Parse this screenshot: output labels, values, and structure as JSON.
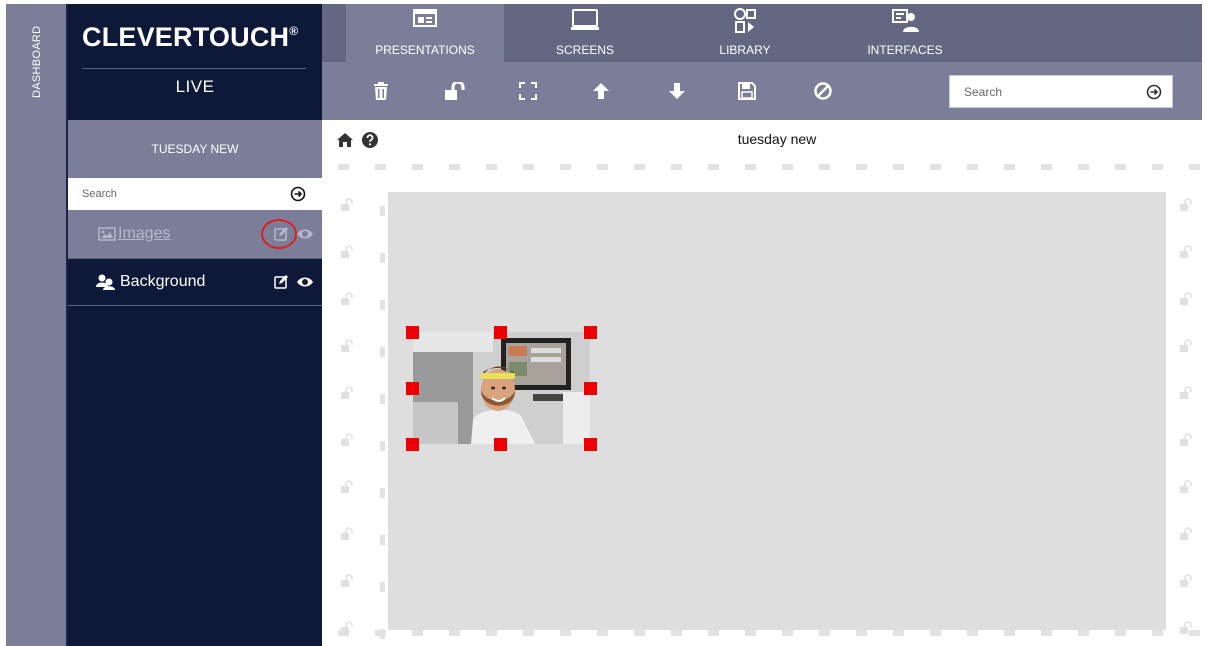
{
  "dashboard": {
    "label": "DASHBOARD"
  },
  "brand": {
    "name": "CLEVERTOUCH",
    "registered": "®",
    "subtitle": "LIVE"
  },
  "nav": {
    "tabs": [
      {
        "label": "PRESENTATIONS",
        "active": true,
        "icon": "presentation-icon"
      },
      {
        "label": "SCREENS",
        "active": false,
        "icon": "monitor-icon"
      },
      {
        "label": "LIBRARY",
        "active": false,
        "icon": "library-media-icon"
      },
      {
        "label": "INTERFACES",
        "active": false,
        "icon": "interface-user-icon"
      }
    ]
  },
  "toolbar": {
    "tools": [
      "trash-icon",
      "unlock-icon",
      "fullscreen-icon",
      "arrow-up-icon",
      "arrow-down-icon",
      "save-icon",
      "ban-icon"
    ],
    "search_placeholder": "Search"
  },
  "sidebar": {
    "title": "TUESDAY NEW",
    "search_placeholder": "Search",
    "layers": [
      {
        "label": "Images",
        "icon": "image-icon",
        "selected": true
      },
      {
        "label": "Background",
        "icon": "users-icon",
        "selected": false
      }
    ]
  },
  "canvas": {
    "title": "tuesday new"
  },
  "colors": {
    "navy": "#0e1838",
    "nav_bg": "#646782",
    "toolbar_bg": "#7c7e99",
    "stage_bg": "#dedede",
    "handle": "#ee0000",
    "highlight": "#dd1f1f"
  }
}
